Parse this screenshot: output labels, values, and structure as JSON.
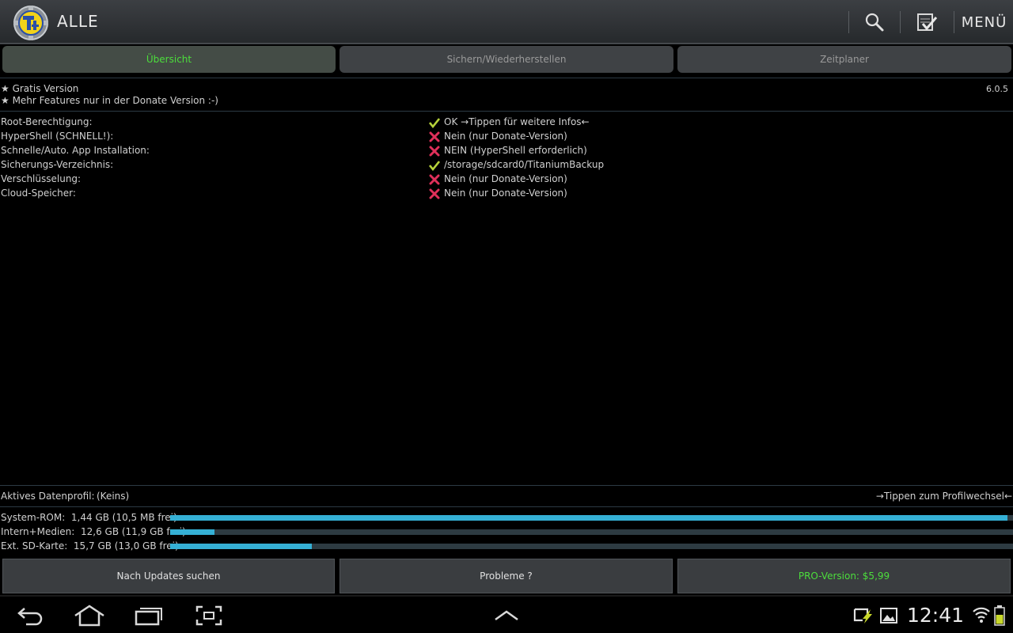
{
  "actionbar": {
    "title": "ALLE",
    "menu_label": "MENÜ",
    "icons": [
      "titanium-backup-logo",
      "search-icon",
      "batch-check-icon"
    ]
  },
  "tabs": [
    {
      "label": "Übersicht",
      "active": true
    },
    {
      "label": "Sichern/Wiederherstellen",
      "active": false
    },
    {
      "label": "Zeitplaner",
      "active": false
    }
  ],
  "info": {
    "line1": "★ Gratis Version",
    "line2": "★ Mehr Features nur in der Donate Version :-)",
    "version": "6.0.5"
  },
  "status": [
    {
      "label": "Root-Berechtigung:",
      "value": "OK →Tippen für weitere Infos←",
      "ok": true
    },
    {
      "label": "HyperShell (SCHNELL!):",
      "value": "Nein (nur Donate-Version)",
      "ok": false
    },
    {
      "label": "Schnelle/Auto. App Installation:",
      "value": "NEIN (HyperShell erforderlich)",
      "ok": false
    },
    {
      "label": "Sicherungs-Verzeichnis:",
      "value": "/storage/sdcard0/TitaniumBackup",
      "ok": true
    },
    {
      "label": "Verschlüsselung:",
      "value": "Nein (nur Donate-Version)",
      "ok": false
    },
    {
      "label": "Cloud-Speicher:",
      "value": "Nein (nur Donate-Version)",
      "ok": false
    }
  ],
  "profile": {
    "label": "Aktives Datenprofil:",
    "value": "(Keins)",
    "hint": "→Tippen zum Profilwechsel←"
  },
  "storage": [
    {
      "label": "System-ROM:",
      "value": "1,44 GB (10,5 MB frei)",
      "used_fraction": 0.993
    },
    {
      "label": "Intern+Medien:",
      "value": "12,6 GB (11,9 GB frei)",
      "used_fraction": 0.053
    },
    {
      "label": "Ext. SD-Karte:",
      "value": "15,7 GB (13,0 GB frei)",
      "used_fraction": 0.168
    }
  ],
  "buttons": {
    "updates": "Nach Updates suchen",
    "problems": "Probleme ?",
    "pro": "PRO-Version: $5,99"
  },
  "colors": {
    "accent_green": "#4cde3c",
    "ok_check": "#b6d23a",
    "error_x": "#e0305a",
    "bar_fill": "#35b0d5"
  },
  "systembar": {
    "clock": "12:41",
    "icons": [
      "back-icon",
      "home-icon",
      "recent-apps-icon",
      "screenshot-icon",
      "up-arrow-icon",
      "sync-notification-icon",
      "gallery-notification-icon",
      "wifi-icon",
      "battery-icon"
    ]
  }
}
